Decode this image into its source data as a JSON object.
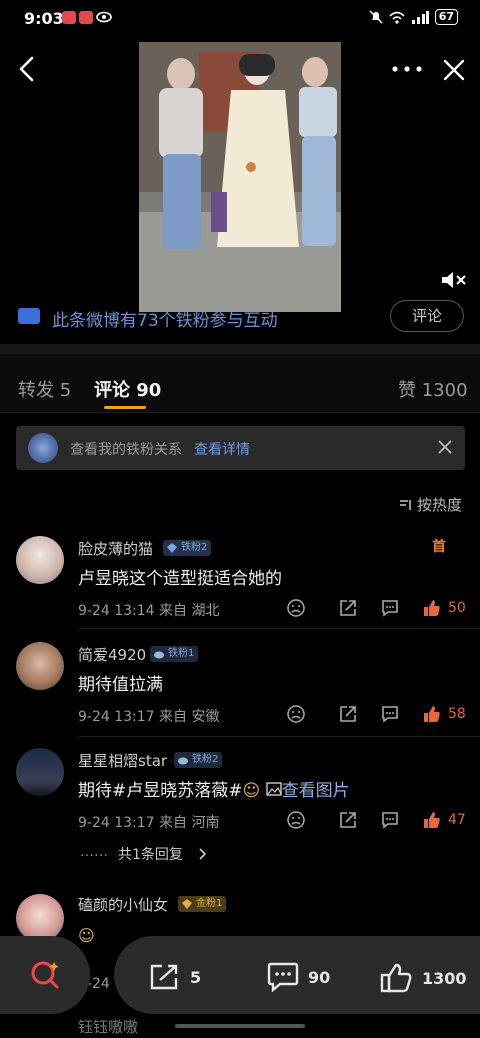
{
  "status_bar": {
    "time": "9:03",
    "battery": "67"
  },
  "promo": {
    "text": "此条微博有73个铁粉参与互动",
    "button": "评论"
  },
  "tabs": {
    "repost": "转发 5",
    "comment": "评论 90",
    "like": "赞 1300"
  },
  "fan_banner": {
    "text": "查看我的铁粉关系",
    "link": "查看详情"
  },
  "sort": {
    "label": "按热度"
  },
  "comments": [
    {
      "user": "脸皮薄的猫",
      "badge": "铁粉2",
      "hot_tag": "首",
      "text": "卢昱晓这个造型挺适合她的",
      "meta": "9-24 13:14 来自 湖北",
      "likes": "50"
    },
    {
      "user": "简爱4920",
      "badge": "铁粉1",
      "text": "期待值拉满",
      "meta": "9-24 13:17 来自 安徽",
      "likes": "58"
    },
    {
      "user": "星星相熠star",
      "badge": "铁粉2",
      "text_prefix": "期待#卢昱晓苏落薇#",
      "text_link": "查看图片",
      "meta": "9-24 13:17 来自 河南",
      "likes": "47",
      "replies": "共1条回复"
    },
    {
      "user": "磕颜的小仙女",
      "badge": "金粉1",
      "meta": "9-24"
    },
    {
      "user": "钰钰嗷嗷"
    }
  ],
  "bottom_bar": {
    "repost": "5",
    "comment": "90",
    "like": "1300"
  },
  "colors": {
    "accent": "#f0a020",
    "like": "#e8673d",
    "link": "#6f9be0"
  }
}
